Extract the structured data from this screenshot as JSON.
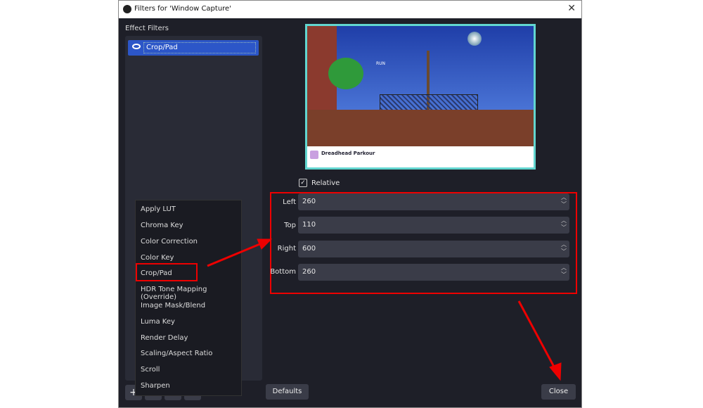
{
  "window": {
    "title": "Filters for 'Window Capture'",
    "close_glyph": "✕"
  },
  "left": {
    "heading": "Effect Filters",
    "filters": [
      {
        "label": "Crop/Pad",
        "visible": true
      }
    ]
  },
  "preview": {
    "game_title": "Dreadhead Parkour",
    "hint": "RUN"
  },
  "relative": {
    "label": "Relative",
    "checked": true
  },
  "fields": [
    {
      "label": "Left",
      "value": "260"
    },
    {
      "label": "Top",
      "value": "110"
    },
    {
      "label": "Right",
      "value": "600"
    },
    {
      "label": "Bottom",
      "value": "260"
    }
  ],
  "menu": [
    "Apply LUT",
    "Chroma Key",
    "Color Correction",
    "Color Key",
    "Crop/Pad",
    "HDR Tone Mapping (Override)",
    "Image Mask/Blend",
    "Luma Key",
    "Render Delay",
    "Scaling/Aspect Ratio",
    "Scroll",
    "Sharpen"
  ],
  "buttons": {
    "add": "+",
    "remove": "−",
    "defaults": "Defaults",
    "close": "Close"
  },
  "colors": {
    "highlight": "#e00000",
    "selection": "#2c56c8"
  }
}
